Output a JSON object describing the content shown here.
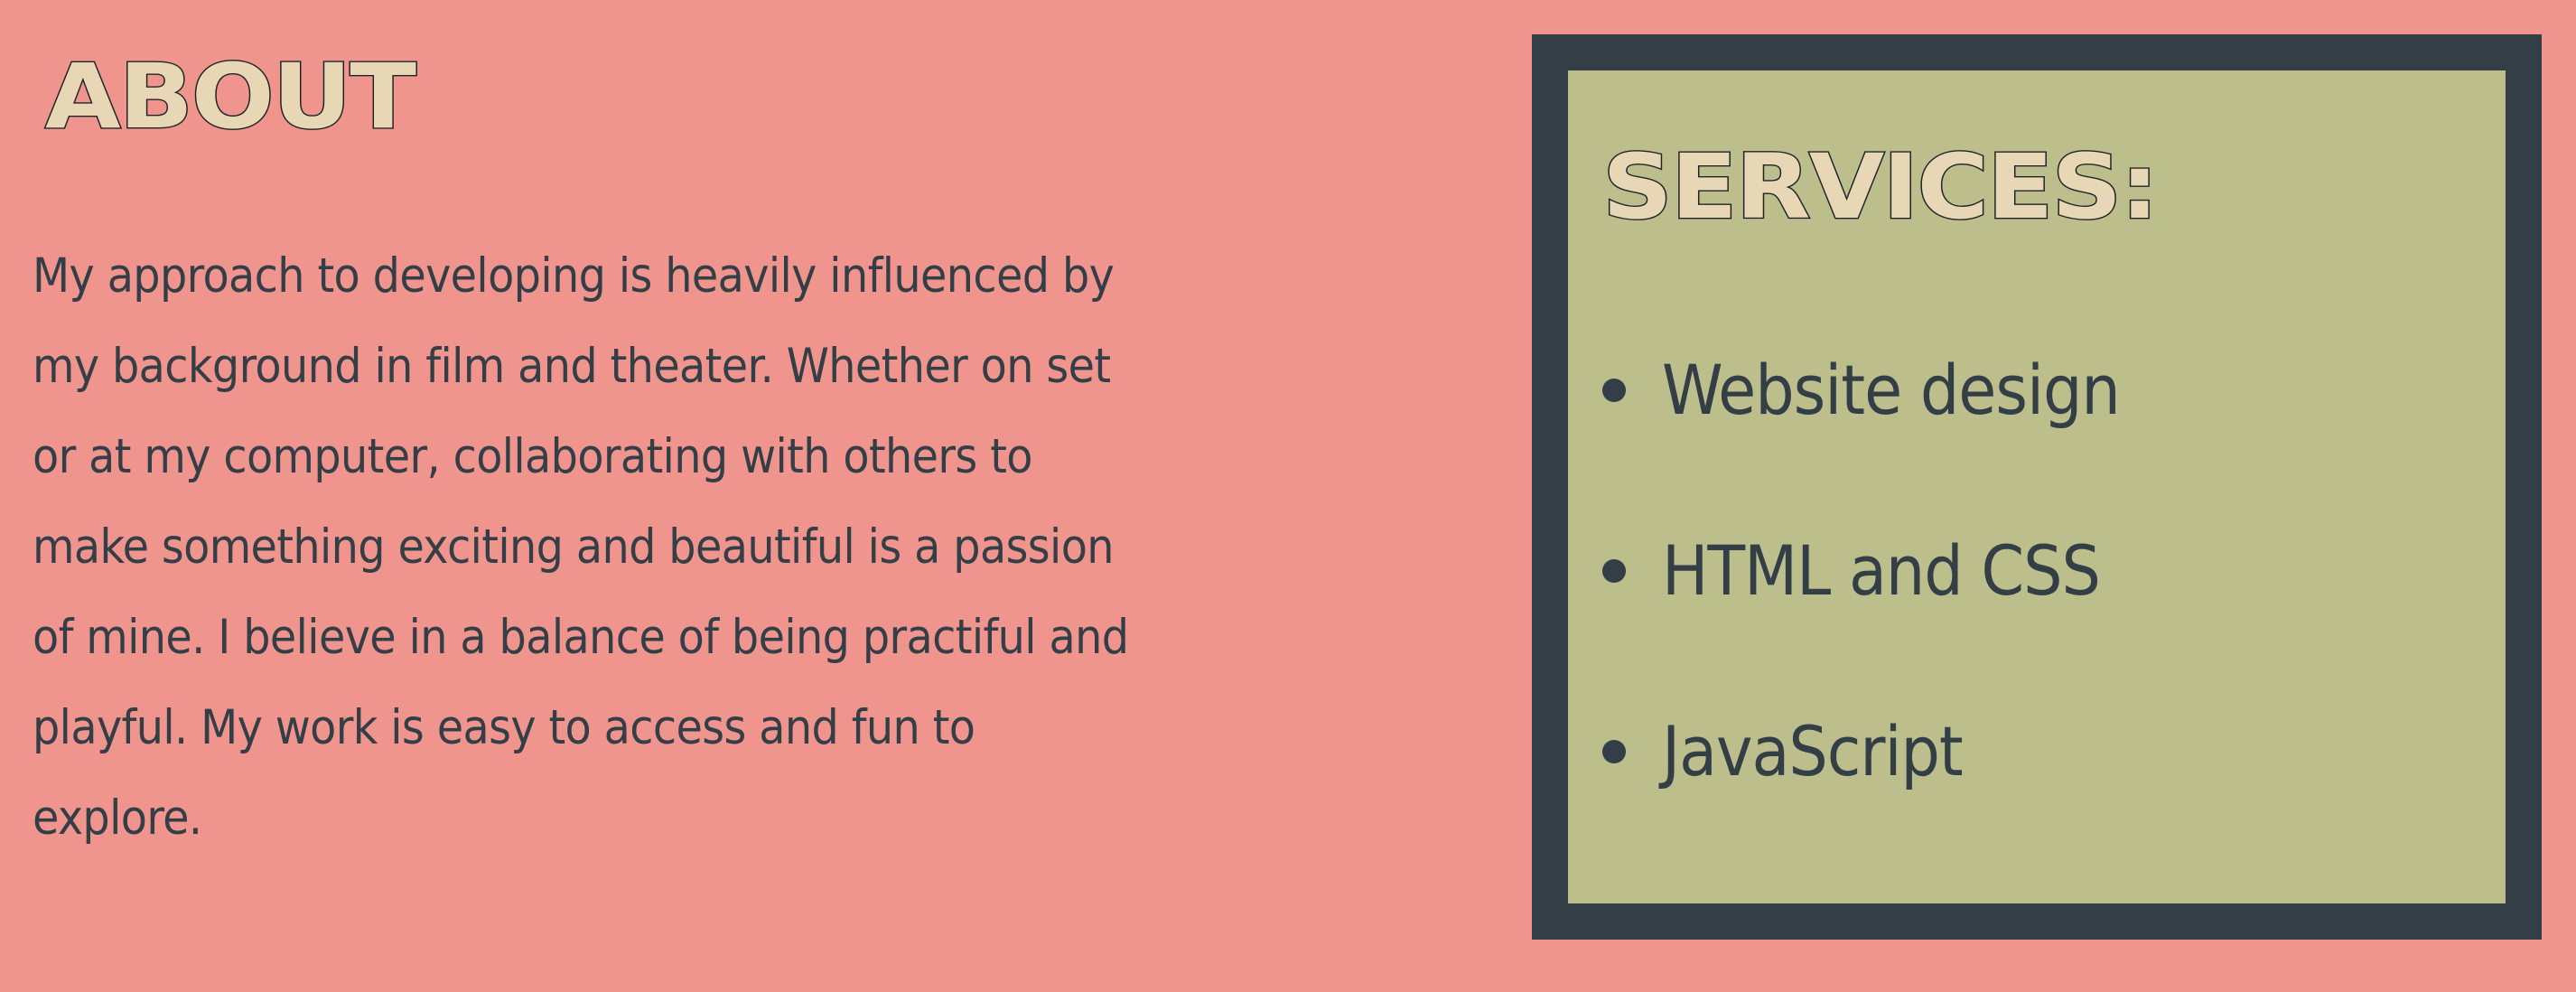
{
  "about": {
    "title": "About",
    "text": "My approach to developing is heavily influenced by my background in film and theater. Whether on set or at my computer, collaborating with others to make something exciting and beautiful is a passion of mine. I believe in a balance of being practiful and playful. My work is easy to access and fun to explore."
  },
  "services": {
    "title": "Services:",
    "items": [
      {
        "label": "Website design"
      },
      {
        "label": "HTML and CSS"
      },
      {
        "label": "JavaScript"
      }
    ]
  },
  "colors": {
    "page_background": "#f0958e",
    "panel_border": "#333e46",
    "panel_background": "#bcbe8b",
    "heading_fill": "#e7d7b5",
    "heading_outline": "#1f2328",
    "body_text": "#333e46"
  }
}
